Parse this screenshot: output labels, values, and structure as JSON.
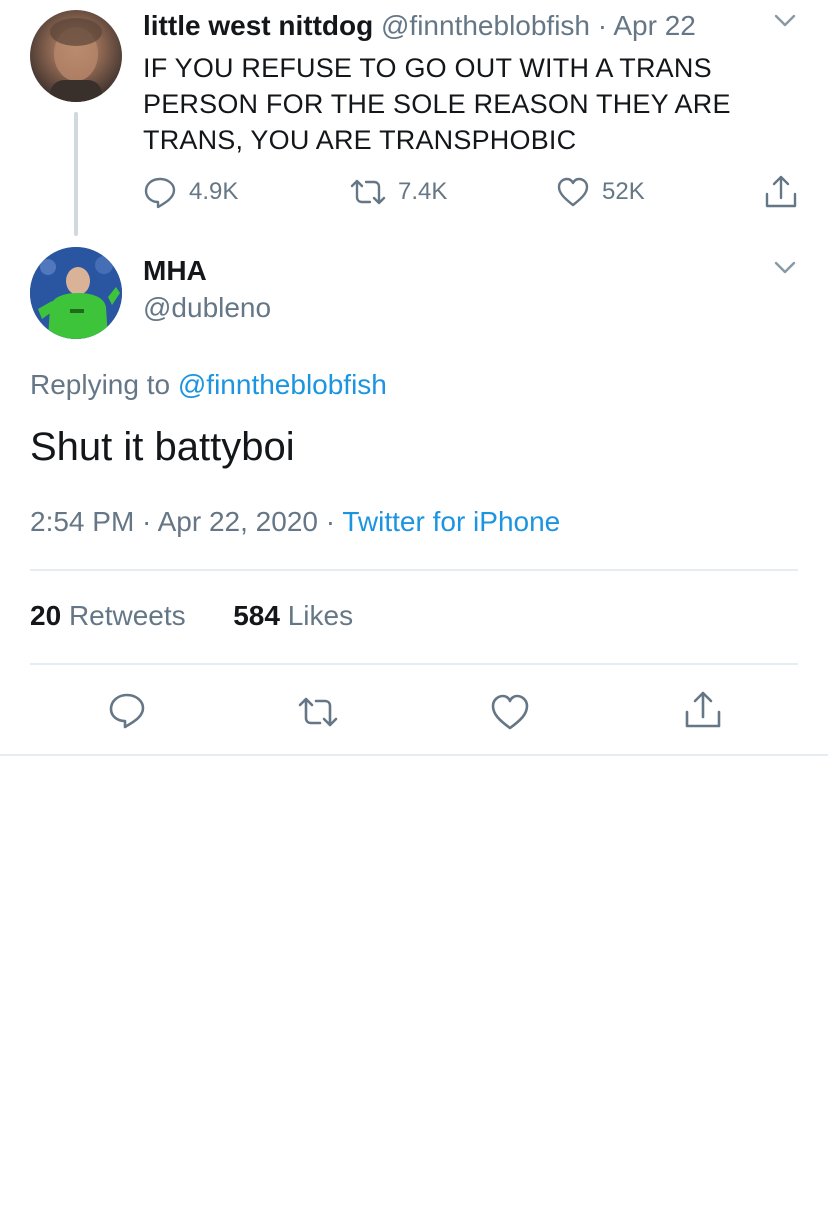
{
  "parent_tweet": {
    "display_name": "little west nittdog",
    "handle": "@finntheblobfish",
    "separator": " · ",
    "date": "Apr 22",
    "text": "IF YOU REFUSE TO GO OUT WITH A TRANS PERSON FOR THE SOLE REASON THEY ARE TRANS, YOU ARE TRANSPHOBIC",
    "actions": {
      "reply_count": "4.9K",
      "retweet_count": "7.4K",
      "like_count": "52K"
    }
  },
  "reply_tweet": {
    "display_name": "MHA",
    "handle": "@dubleno",
    "replying_prefix": "Replying to ",
    "replying_to": "@finntheblobfish",
    "text": "Shut it battyboi",
    "time": "2:54 PM",
    "dot": " · ",
    "date": "Apr 22, 2020",
    "source": "Twitter for iPhone",
    "retweets_count": "20",
    "retweets_label": "Retweets",
    "likes_count": "584",
    "likes_label": "Likes"
  },
  "colors": {
    "link": "#1b95e0",
    "secondary_text": "#657786",
    "primary_text": "#14171a",
    "divider": "#e6ecf0"
  },
  "icons": [
    "reply-icon",
    "retweet-icon",
    "like-icon",
    "share-icon",
    "chevron-down-icon"
  ]
}
